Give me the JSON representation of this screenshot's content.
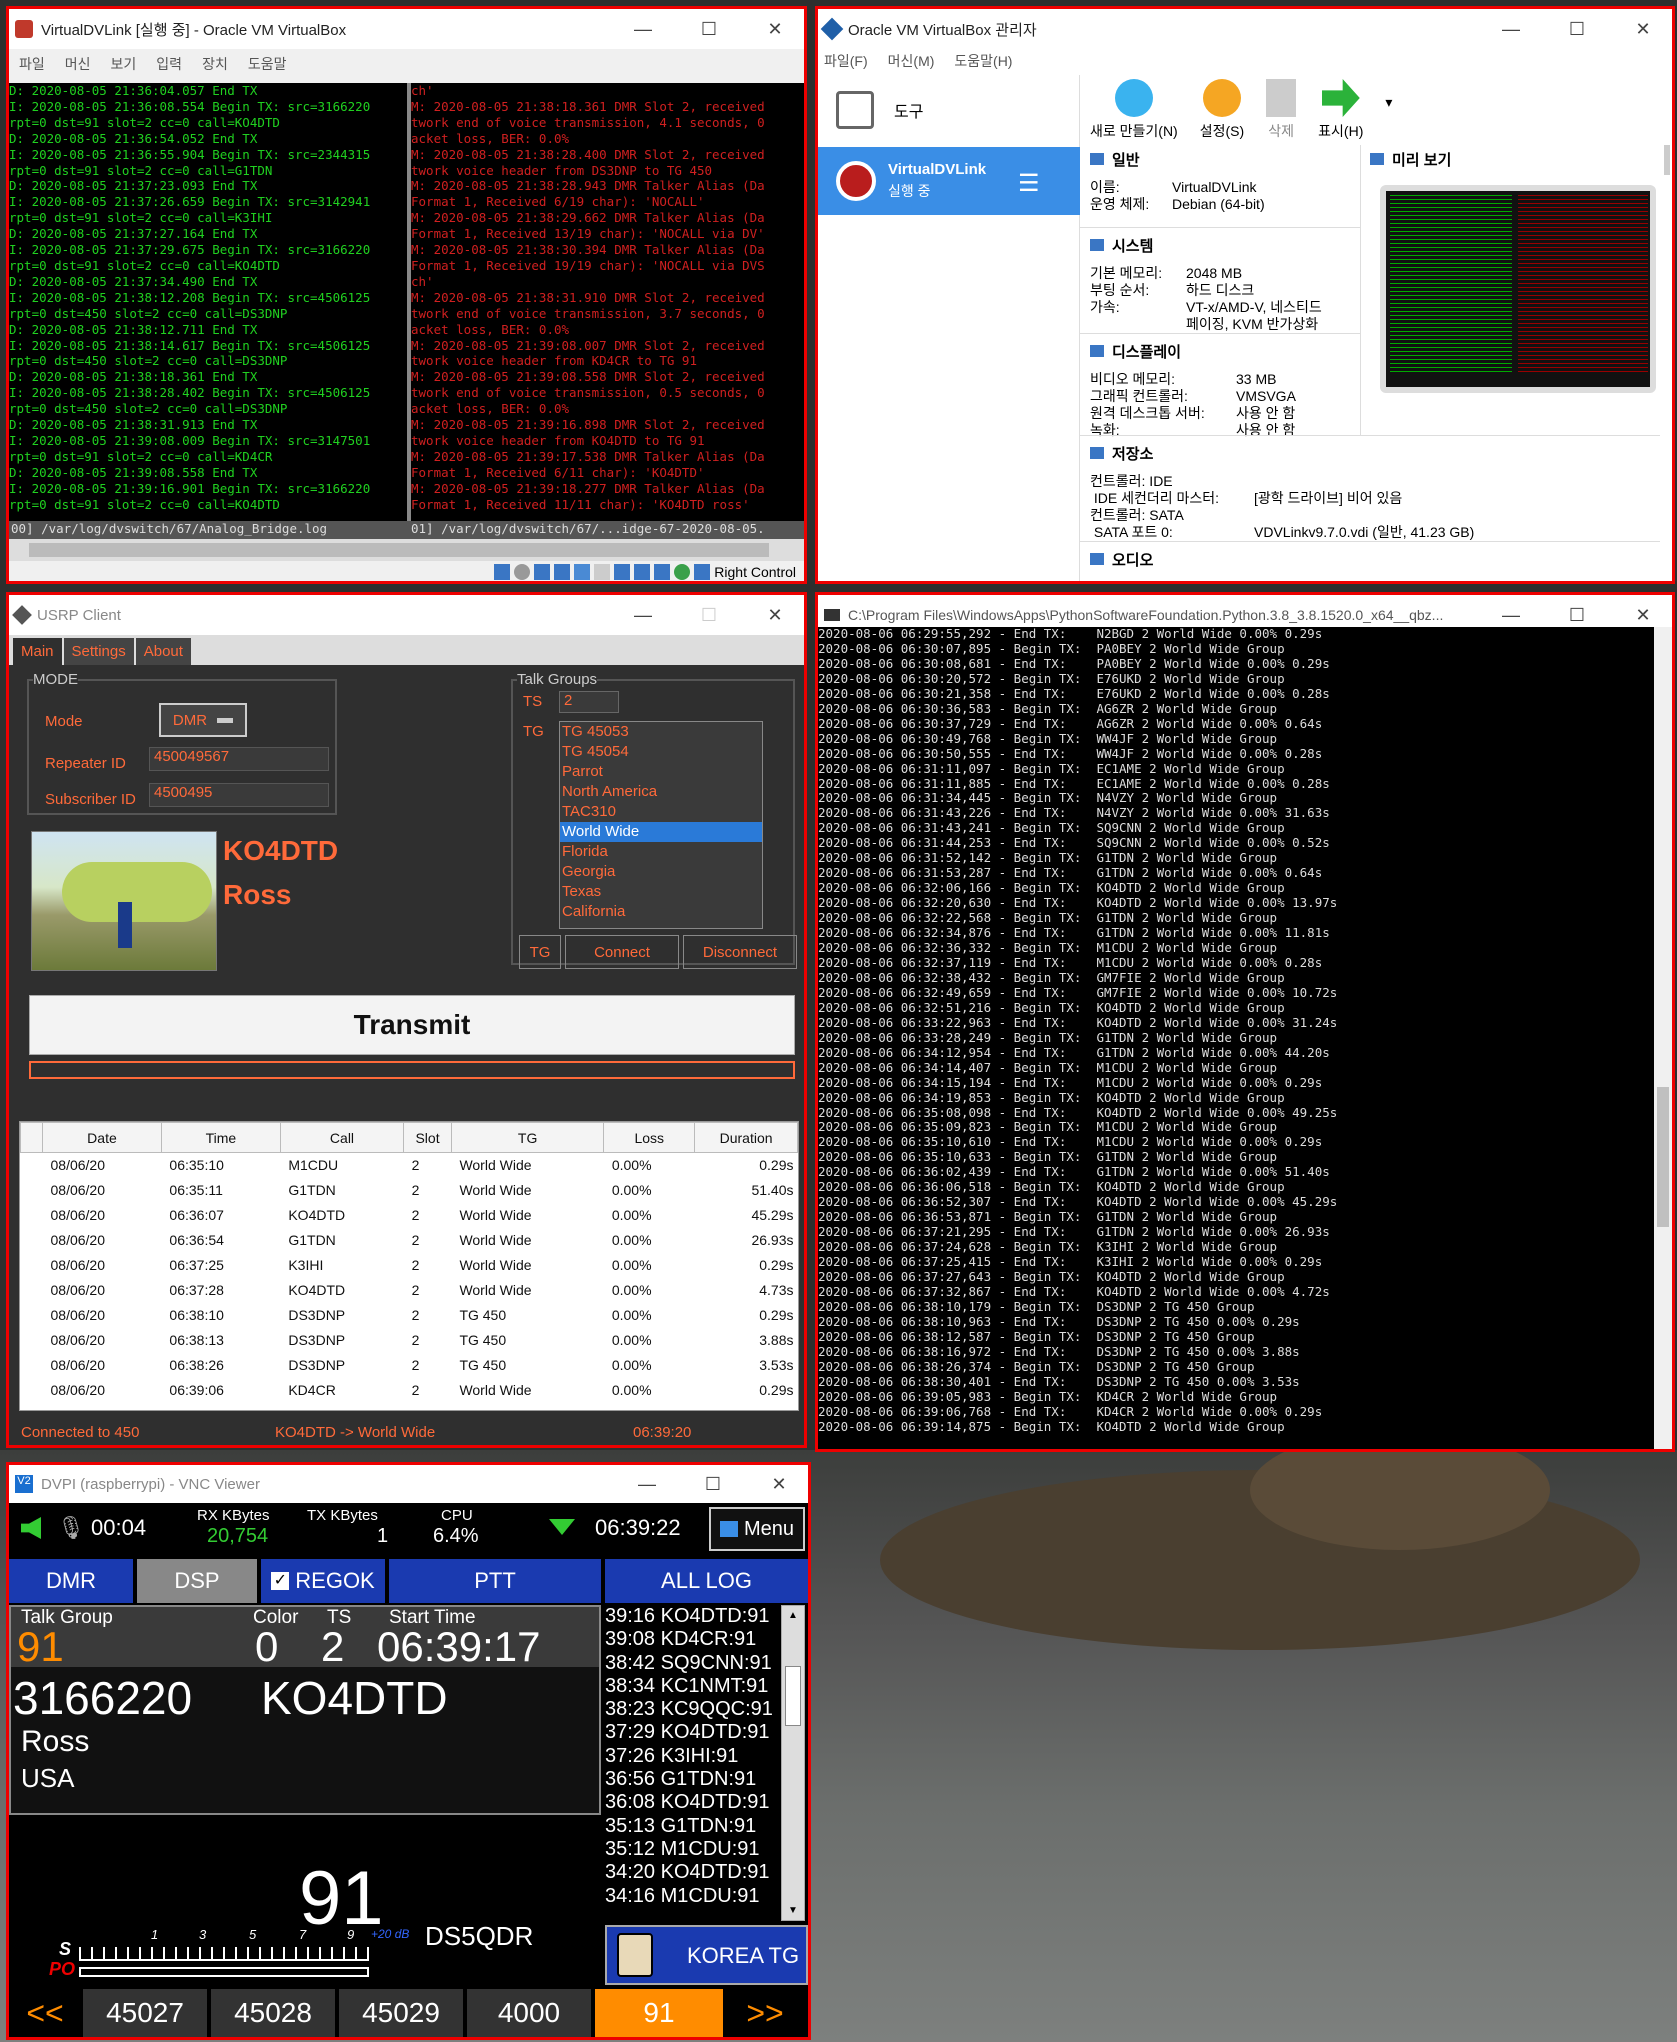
{
  "vbox_vm": {
    "title": "VirtualDVLink [실행 중] - Oracle VM VirtualBox",
    "menu": [
      "파일",
      "머신",
      "보기",
      "입력",
      "장치",
      "도움말"
    ],
    "left_lines": [
      "D: 2020-08-05 21:36:04.057 End TX",
      "I: 2020-08-05 21:36:08.554 Begin TX: src=3166220",
      "rpt=0 dst=91 slot=2 cc=0 call=KO4DTD",
      "D: 2020-08-05 21:36:54.052 End TX",
      "I: 2020-08-05 21:36:55.904 Begin TX: src=2344315",
      "rpt=0 dst=91 slot=2 cc=0 call=G1TDN",
      "D: 2020-08-05 21:37:23.093 End TX",
      "I: 2020-08-05 21:37:26.659 Begin TX: src=3142941",
      "rpt=0 dst=91 slot=2 cc=0 call=K3IHI",
      "D: 2020-08-05 21:37:27.164 End TX",
      "I: 2020-08-05 21:37:29.675 Begin TX: src=3166220",
      "rpt=0 dst=91 slot=2 cc=0 call=KO4DTD",
      "D: 2020-08-05 21:37:34.490 End TX",
      "I: 2020-08-05 21:38:12.208 Begin TX: src=4506125",
      "rpt=0 dst=450 slot=2 cc=0 call=DS3DNP",
      "D: 2020-08-05 21:38:12.711 End TX",
      "I: 2020-08-05 21:38:14.617 Begin TX: src=4506125",
      "rpt=0 dst=450 slot=2 cc=0 call=DS3DNP",
      "D: 2020-08-05 21:38:18.361 End TX",
      "I: 2020-08-05 21:38:28.402 Begin TX: src=4506125",
      "rpt=0 dst=450 slot=2 cc=0 call=DS3DNP",
      "D: 2020-08-05 21:38:31.913 End TX",
      "I: 2020-08-05 21:39:08.009 Begin TX: src=3147501",
      "rpt=0 dst=91 slot=2 cc=0 call=KD4CR",
      "D: 2020-08-05 21:39:08.558 End TX",
      "I: 2020-08-05 21:39:16.901 Begin TX: src=3166220",
      "rpt=0 dst=91 slot=2 cc=0 call=KO4DTD"
    ],
    "right_lines": [
      "ch'",
      "M: 2020-08-05 21:38:18.361 DMR Slot 2, received",
      "twork end of voice transmission, 4.1 seconds, 0",
      "acket loss, BER: 0.0%",
      "M: 2020-08-05 21:38:28.400 DMR Slot 2, received",
      "twork voice header from DS3DNP to TG 450",
      "M: 2020-08-05 21:38:28.943 DMR Talker Alias (Da",
      "Format 1, Received 6/19 char): 'NOCALL'",
      "M: 2020-08-05 21:38:29.662 DMR Talker Alias (Da",
      "Format 1, Received 13/19 char): 'NOCALL via DV'",
      "M: 2020-08-05 21:38:30.394 DMR Talker Alias (Da",
      "Format 1, Received 19/19 char): 'NOCALL via DVS",
      "ch'",
      "M: 2020-08-05 21:38:31.910 DMR Slot 2, received",
      "twork end of voice transmission, 3.7 seconds, 0",
      "acket loss, BER: 0.0%",
      "M: 2020-08-05 21:39:08.007 DMR Slot 2, received",
      "twork voice header from KD4CR to TG 91",
      "M: 2020-08-05 21:39:08.558 DMR Slot 2, received",
      "twork end of voice transmission, 0.5 seconds, 0",
      "acket loss, BER: 0.0%",
      "M: 2020-08-05 21:39:16.898 DMR Slot 2, received",
      "twork voice header from KO4DTD to TG 91",
      "M: 2020-08-05 21:39:17.538 DMR Talker Alias (Da",
      "Format 1, Received 6/11 char): 'KO4DTD'",
      "M: 2020-08-05 21:39:18.277 DMR Talker Alias (Da",
      "Format 1, Received 11/11 char): 'KO4DTD ross'"
    ],
    "status_left": "00] /var/log/dvswitch/67/Analog_Bridge.log",
    "status_right": "01] /var/log/dvswitch/67/...idge-67-2020-08-05.",
    "host_key": "Right Control"
  },
  "vbox_mgr": {
    "title": "Oracle VM VirtualBox 관리자",
    "menu": [
      "파일(F)",
      "머신(M)",
      "도움말(H)"
    ],
    "tools": "도구",
    "vm_name": "VirtualDVLink",
    "vm_state": "실행 중",
    "toolbar": [
      "새로 만들기(N)",
      "설정(S)",
      "삭제",
      "표시(H)"
    ],
    "preview_title": "미리 보기",
    "general": {
      "title": "일반",
      "rows": [
        [
          "이름:",
          "VirtualDVLink"
        ],
        [
          "운영 체제:",
          "Debian (64-bit)"
        ]
      ]
    },
    "system": {
      "title": "시스템",
      "rows": [
        [
          "기본 메모리:",
          "2048 MB"
        ],
        [
          "부팅 순서:",
          "하드 디스크"
        ],
        [
          "가속:",
          "VT-x/AMD-V, 네스티드"
        ],
        [
          "",
          "페이징, KVM 반가상화"
        ]
      ]
    },
    "display": {
      "title": "디스플레이",
      "rows": [
        [
          "비디오 메모리:",
          "33 MB"
        ],
        [
          "그래픽 컨트롤러:",
          "VMSVGA"
        ],
        [
          "원격 데스크톱 서버:",
          "사용 안 함"
        ],
        [
          "녹화:",
          "사용 안 함"
        ]
      ]
    },
    "storage": {
      "title": "저장소",
      "rows": [
        [
          "컨트롤러: IDE",
          ""
        ],
        [
          " IDE 세컨더리 마스터:",
          "[광학 드라이브] 비어 있음"
        ],
        [
          "컨트롤러: SATA",
          ""
        ],
        [
          " SATA 포트 0:",
          "VDVLinkv9.7.0.vdi (일반, 41.23 GB)"
        ]
      ]
    },
    "audio": {
      "title": "오디오"
    }
  },
  "usrp": {
    "title": "USRP Client",
    "tabs": [
      "Main",
      "Settings",
      "About"
    ],
    "mode_group": "MODE",
    "mode_label": "Mode",
    "mode_value": "DMR",
    "repeater_label": "Repeater ID",
    "repeater_value": "450049567",
    "subscriber_label": "Subscriber ID",
    "subscriber_value": "4500495",
    "call": "KO4DTD",
    "name": "Ross",
    "tg_group": "Talk Groups",
    "ts_label": "TS",
    "ts_value": "2",
    "tg_label": "TG",
    "tg_list": [
      "TG 45053",
      "TG 45054",
      "Parrot",
      "North America",
      "TAC310",
      "World Wide",
      "Florida",
      "Georgia",
      "Texas",
      "California"
    ],
    "tg_selected": "World Wide",
    "btn_tg": "TG",
    "btn_connect": "Connect",
    "btn_disconnect": "Disconnect",
    "transmit": "Transmit",
    "columns": [
      "Date",
      "Time",
      "Call",
      "Slot",
      "TG",
      "Loss",
      "Duration"
    ],
    "rows": [
      [
        "08/06/20",
        "06:35:10",
        "M1CDU",
        "2",
        "World Wide",
        "0.00%",
        "0.29s"
      ],
      [
        "08/06/20",
        "06:35:11",
        "G1TDN",
        "2",
        "World Wide",
        "0.00%",
        "51.40s"
      ],
      [
        "08/06/20",
        "06:36:07",
        "KO4DTD",
        "2",
        "World Wide",
        "0.00%",
        "45.29s"
      ],
      [
        "08/06/20",
        "06:36:54",
        "G1TDN",
        "2",
        "World Wide",
        "0.00%",
        "26.93s"
      ],
      [
        "08/06/20",
        "06:37:25",
        "K3IHI",
        "2",
        "World Wide",
        "0.00%",
        "0.29s"
      ],
      [
        "08/06/20",
        "06:37:28",
        "KO4DTD",
        "2",
        "World Wide",
        "0.00%",
        "4.73s"
      ],
      [
        "08/06/20",
        "06:38:10",
        "DS3DNP",
        "2",
        "TG 450",
        "0.00%",
        "0.29s"
      ],
      [
        "08/06/20",
        "06:38:13",
        "DS3DNP",
        "2",
        "TG 450",
        "0.00%",
        "3.88s"
      ],
      [
        "08/06/20",
        "06:38:26",
        "DS3DNP",
        "2",
        "TG 450",
        "0.00%",
        "3.53s"
      ],
      [
        "08/06/20",
        "06:39:06",
        "KD4CR",
        "2",
        "World Wide",
        "0.00%",
        "0.29s"
      ]
    ],
    "status_left": "Connected to 450",
    "status_mid": "KO4DTD -> World Wide",
    "status_right": "06:39:20"
  },
  "console": {
    "title": "C:\\Program Files\\WindowsApps\\PythonSoftwareFoundation.Python.3.8_3.8.1520.0_x64__qbz...",
    "lines": [
      "2020-08-06 06:29:55,292 - End TX:    N2BGD 2 World Wide 0.00% 0.29s",
      "2020-08-06 06:30:07,895 - Begin TX:  PA0BEY 2 World Wide Group",
      "2020-08-06 06:30:08,681 - End TX:    PA0BEY 2 World Wide 0.00% 0.29s",
      "2020-08-06 06:30:20,572 - Begin TX:  E76UKD 2 World Wide Group",
      "2020-08-06 06:30:21,358 - End TX:    E76UKD 2 World Wide 0.00% 0.28s",
      "2020-08-06 06:30:36,583 - Begin TX:  AG6ZR 2 World Wide Group",
      "2020-08-06 06:30:37,729 - End TX:    AG6ZR 2 World Wide 0.00% 0.64s",
      "2020-08-06 06:30:49,768 - Begin TX:  WW4JF 2 World Wide Group",
      "2020-08-06 06:30:50,555 - End TX:    WW4JF 2 World Wide 0.00% 0.28s",
      "2020-08-06 06:31:11,097 - Begin TX:  EC1AME 2 World Wide Group",
      "2020-08-06 06:31:11,885 - End TX:    EC1AME 2 World Wide 0.00% 0.28s",
      "2020-08-06 06:31:34,445 - Begin TX:  N4VZY 2 World Wide Group",
      "2020-08-06 06:31:43,226 - End TX:    N4VZY 2 World Wide 0.00% 31.63s",
      "2020-08-06 06:31:43,241 - Begin TX:  SQ9CNN 2 World Wide Group",
      "2020-08-06 06:31:44,253 - End TX:    SQ9CNN 2 World Wide 0.00% 0.52s",
      "2020-08-06 06:31:52,142 - Begin TX:  G1TDN 2 World Wide Group",
      "2020-08-06 06:31:53,287 - End TX:    G1TDN 2 World Wide 0.00% 0.64s",
      "2020-08-06 06:32:06,166 - Begin TX:  KO4DTD 2 World Wide Group",
      "2020-08-06 06:32:20,630 - End TX:    KO4DTD 2 World Wide 0.00% 13.97s",
      "2020-08-06 06:32:22,568 - Begin TX:  G1TDN 2 World Wide Group",
      "2020-08-06 06:32:34,876 - End TX:    G1TDN 2 World Wide 0.00% 11.81s",
      "2020-08-06 06:32:36,332 - Begin TX:  M1CDU 2 World Wide Group",
      "2020-08-06 06:32:37,119 - End TX:    M1CDU 2 World Wide 0.00% 0.28s",
      "2020-08-06 06:32:38,432 - Begin TX:  GM7FIE 2 World Wide Group",
      "2020-08-06 06:32:49,659 - End TX:    GM7FIE 2 World Wide 0.00% 10.72s",
      "2020-08-06 06:32:51,216 - Begin TX:  KO4DTD 2 World Wide Group",
      "2020-08-06 06:33:22,963 - End TX:    KO4DTD 2 World Wide 0.00% 31.24s",
      "2020-08-06 06:33:28,249 - Begin TX:  G1TDN 2 World Wide Group",
      "2020-08-06 06:34:12,954 - End TX:    G1TDN 2 World Wide 0.00% 44.20s",
      "2020-08-06 06:34:14,407 - Begin TX:  M1CDU 2 World Wide Group",
      "2020-08-06 06:34:15,194 - End TX:    M1CDU 2 World Wide 0.00% 0.29s",
      "2020-08-06 06:34:19,853 - Begin TX:  KO4DTD 2 World Wide Group",
      "2020-08-06 06:35:08,098 - End TX:    KO4DTD 2 World Wide 0.00% 49.25s",
      "2020-08-06 06:35:09,823 - Begin TX:  M1CDU 2 World Wide Group",
      "2020-08-06 06:35:10,610 - End TX:    M1CDU 2 World Wide 0.00% 0.29s",
      "2020-08-06 06:35:10,633 - Begin TX:  G1TDN 2 World Wide Group",
      "2020-08-06 06:36:02,439 - End TX:    G1TDN 2 World Wide 0.00% 51.40s",
      "2020-08-06 06:36:06,518 - Begin TX:  KO4DTD 2 World Wide Group",
      "2020-08-06 06:36:52,307 - End TX:    KO4DTD 2 World Wide 0.00% 45.29s",
      "2020-08-06 06:36:53,871 - Begin TX:  G1TDN 2 World Wide Group",
      "2020-08-06 06:37:21,295 - End TX:    G1TDN 2 World Wide 0.00% 26.93s",
      "2020-08-06 06:37:24,628 - Begin TX:  K3IHI 2 World Wide Group",
      "2020-08-06 06:37:25,415 - End TX:    K3IHI 2 World Wide 0.00% 0.29s",
      "2020-08-06 06:37:27,643 - Begin TX:  KO4DTD 2 World Wide Group",
      "2020-08-06 06:37:32,867 - End TX:    KO4DTD 2 World Wide 0.00% 4.72s",
      "2020-08-06 06:38:10,179 - Begin TX:  DS3DNP 2 TG 450 Group",
      "2020-08-06 06:38:10,963 - End TX:    DS3DNP 2 TG 450 0.00% 0.29s",
      "2020-08-06 06:38:12,587 - Begin TX:  DS3DNP 2 TG 450 Group",
      "2020-08-06 06:38:16,972 - End TX:    DS3DNP 2 TG 450 0.00% 3.88s",
      "2020-08-06 06:38:26,374 - Begin TX:  DS3DNP 2 TG 450 Group",
      "2020-08-06 06:38:30,401 - End TX:    DS3DNP 2 TG 450 0.00% 3.53s",
      "2020-08-06 06:39:05,983 - Begin TX:  KD4CR 2 World Wide Group",
      "2020-08-06 06:39:06,768 - End TX:    KD4CR 2 World Wide 0.00% 0.29s",
      "2020-08-06 06:39:14,875 - Begin TX:  KO4DTD 2 World Wide Group"
    ]
  },
  "vnc": {
    "title": "DVPI (raspberrypi) - VNC Viewer",
    "elapsed": "00:04",
    "rx_label": "RX KBytes",
    "rx_value": "20,754",
    "tx_label": "TX KBytes",
    "tx_value": "1",
    "cpu_label": "CPU",
    "cpu_value": "6.4%",
    "clock": "06:39:22",
    "menu": "Menu",
    "tabs": [
      "DMR",
      "DSP",
      "REGOK",
      "PTT",
      "ALL LOG"
    ],
    "tg_label": "Talk Group",
    "tg_value": "91",
    "color_label": "Color",
    "color_value": "0",
    "ts_label": "TS",
    "ts_value": "2",
    "start_label": "Start Time",
    "start_value": "06:39:17",
    "id": "3166220",
    "call": "KO4DTD",
    "name": "Ross",
    "country": "USA",
    "big_tg": "91",
    "callsign": "DS5QDR",
    "meter_s": "S",
    "meter_po": "PO",
    "meter_scale": [
      "1",
      "3",
      "5",
      "7",
      "9",
      "+20 dB"
    ],
    "korea": "KOREA TG",
    "log": [
      "39:16 KO4DTD:91",
      "39:08 KD4CR:91",
      "38:42 SQ9CNN:91",
      "38:34 KC1NMT:91",
      "38:23 KC9QQC:91",
      "37:29 KO4DTD:91",
      "37:26 K3IHI:91",
      "36:56 G1TDN:91",
      "36:08 KO4DTD:91",
      "35:13 G1TDN:91",
      "35:12 M1CDU:91",
      "34:20 KO4DTD:91",
      "34:16 M1CDU:91"
    ],
    "bottom": [
      "<<",
      "45027",
      "45028",
      "45029",
      "4000",
      "91",
      ">>"
    ],
    "accent": "#ff8c00"
  }
}
